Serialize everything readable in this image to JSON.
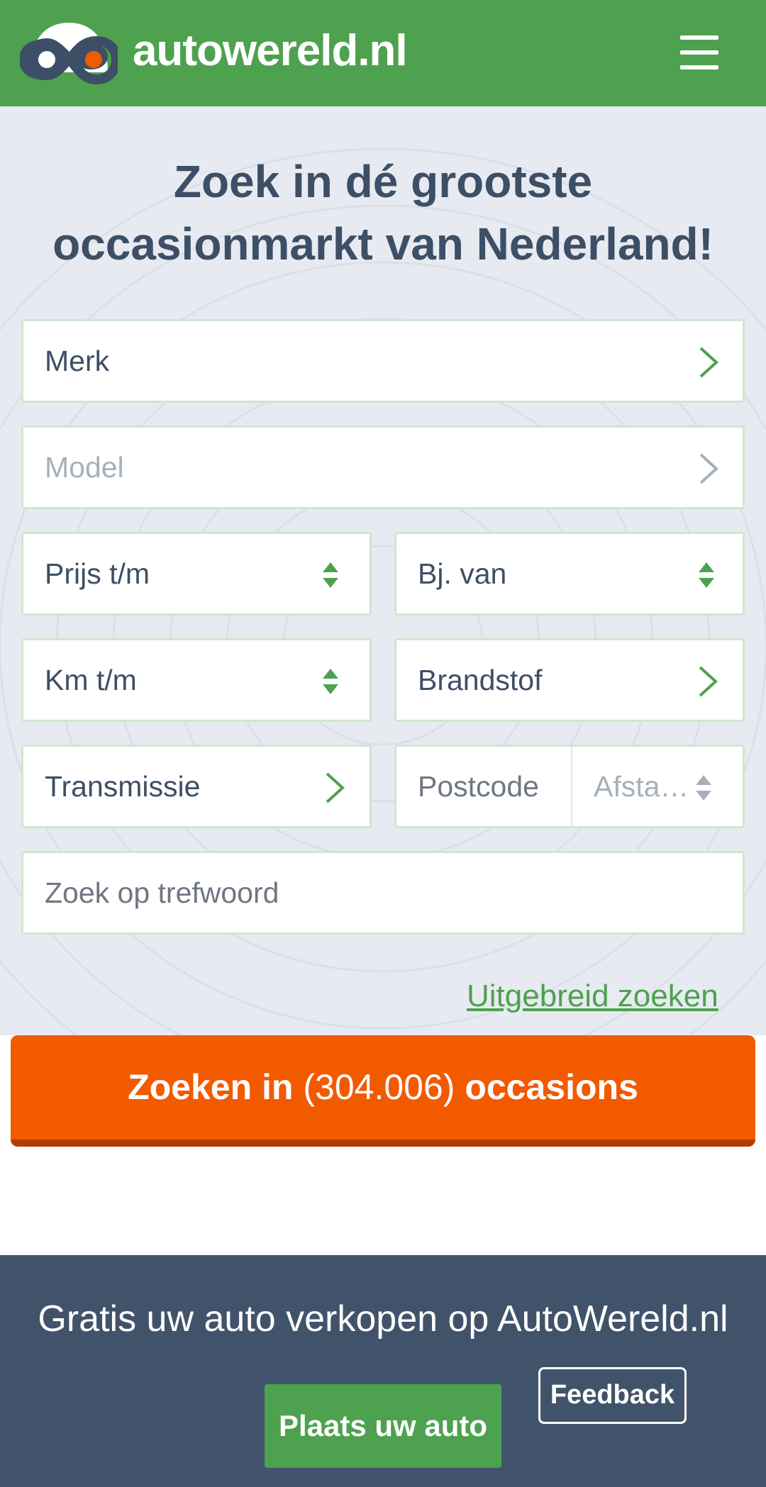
{
  "header": {
    "logo_text": "autowereld.nl",
    "logo_icon": "infinity-car-icon",
    "menu_icon": "hamburger-menu-icon",
    "brand_green": "#4ea14f"
  },
  "hero": {
    "title_line1": "Zoek in dé grootste",
    "title_line2": "occasionmarkt van Nederland!"
  },
  "form": {
    "merk": "Merk",
    "model": "Model",
    "prijs": "Prijs t/m",
    "bouwjaar": "Bj. van",
    "km": "Km t/m",
    "brandstof": "Brandstof",
    "transmissie": "Transmissie",
    "postcode_placeholder": "Postcode",
    "afstand": "Afsta…",
    "trefwoord_placeholder": "Zoek op trefwoord",
    "advanced_link": "Uitgebreid zoeken"
  },
  "search_button": {
    "prefix": "Zoeken in",
    "count": "(304.006)",
    "suffix": "occasions",
    "color": "#f25a00"
  },
  "sell": {
    "title": "Gratis uw auto verkopen op AutoWereld.nl",
    "button": "Plaats uw auto"
  },
  "feedback": "Feedback"
}
